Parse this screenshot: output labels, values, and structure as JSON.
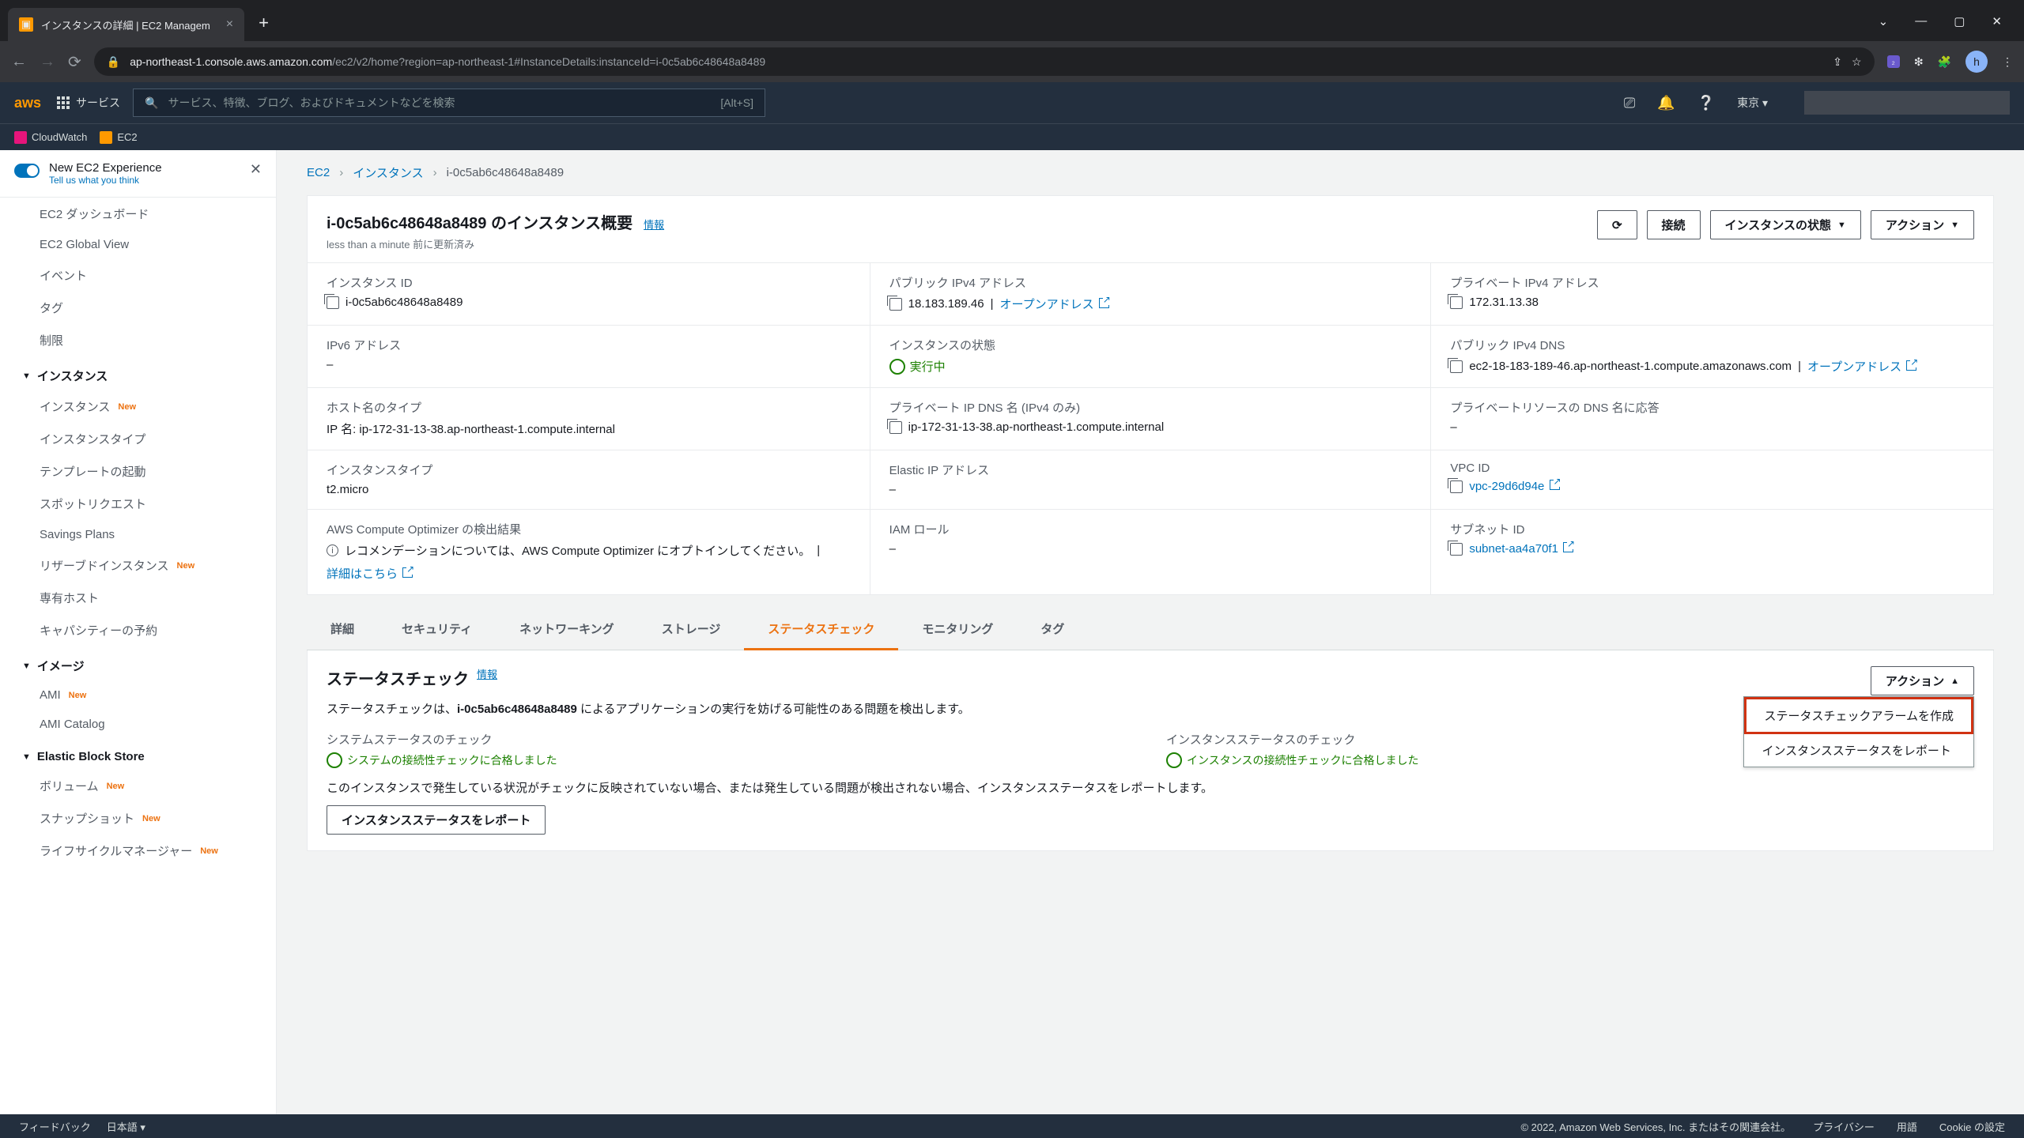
{
  "browser": {
    "tab_title": "インスタンスの詳細 | EC2 Managem",
    "url_host": "ap-northeast-1.console.aws.amazon.com",
    "url_path": "/ec2/v2/home?region=ap-northeast-1#InstanceDetails:instanceId=i-0c5ab6c48648a8489",
    "avatar": "h"
  },
  "aws_nav": {
    "services": "サービス",
    "search_placeholder": "サービス、特徴、ブログ、およびドキュメントなどを検索",
    "search_kbd": "[Alt+S]",
    "region": "東京 ▾",
    "fav1": "CloudWatch",
    "fav2": "EC2"
  },
  "sidebar": {
    "newexp_title": "New EC2 Experience",
    "newexp_sub": "Tell us what you think",
    "items_top": [
      "EC2 ダッシュボード",
      "EC2 Global View",
      "イベント",
      "タグ",
      "制限"
    ],
    "grp_instances": "インスタンス",
    "items_instances": [
      {
        "label": "インスタンス",
        "new": true
      },
      {
        "label": "インスタンスタイプ",
        "new": false
      },
      {
        "label": "テンプレートの起動",
        "new": false
      },
      {
        "label": "スポットリクエスト",
        "new": false
      },
      {
        "label": "Savings Plans",
        "new": false
      },
      {
        "label": "リザーブドインスタンス",
        "new": true
      },
      {
        "label": "専有ホスト",
        "new": false
      },
      {
        "label": "キャパシティーの予約",
        "new": false
      }
    ],
    "grp_images": "イメージ",
    "items_images": [
      {
        "label": "AMI",
        "new": true
      },
      {
        "label": "AMI Catalog",
        "new": false
      }
    ],
    "grp_ebs": "Elastic Block Store",
    "items_ebs": [
      {
        "label": "ボリューム",
        "new": true
      },
      {
        "label": "スナップショット",
        "new": true
      },
      {
        "label": "ライフサイクルマネージャー",
        "new": true
      }
    ]
  },
  "breadcrumb": {
    "ec2": "EC2",
    "instances": "インスタンス",
    "current": "i-0c5ab6c48648a8489"
  },
  "header": {
    "title": "i-0c5ab6c48648a8489 のインスタンス概要",
    "info": "情報",
    "updated": "less than a minute 前に更新済み",
    "btn_connect": "接続",
    "btn_state": "インスタンスの状態",
    "btn_actions": "アクション"
  },
  "details": {
    "instance_id_label": "インスタンス ID",
    "instance_id": "i-0c5ab6c48648a8489",
    "public_ipv4_label": "パブリック IPv4 アドレス",
    "public_ipv4": "18.183.189.46",
    "open_address": "オープンアドレス",
    "private_ipv4_label": "プライベート IPv4 アドレス",
    "private_ipv4": "172.31.13.38",
    "ipv6_label": "IPv6 アドレス",
    "ipv6": "–",
    "state_label": "インスタンスの状態",
    "state": "実行中",
    "public_dns_label": "パブリック IPv4 DNS",
    "public_dns": "ec2-18-183-189-46.ap-northeast-1.compute.amazonaws.com",
    "hostname_type_label": "ホスト名のタイプ",
    "hostname_type": "IP 名: ip-172-31-13-38.ap-northeast-1.compute.internal",
    "private_dns_label": "プライベート IP DNS 名 (IPv4 のみ)",
    "private_dns": "ip-172-31-13-38.ap-northeast-1.compute.internal",
    "private_resource_dns_label": "プライベートリソースの DNS 名に応答",
    "private_resource_dns": "–",
    "instance_type_label": "インスタンスタイプ",
    "instance_type": "t2.micro",
    "elastic_ip_label": "Elastic IP アドレス",
    "elastic_ip": "–",
    "vpc_label": "VPC ID",
    "vpc": "vpc-29d6d94e",
    "compute_opt_label": "AWS Compute Optimizer の検出結果",
    "compute_opt": "レコメンデーションについては、AWS Compute Optimizer にオプトインしてください。",
    "compute_opt_link": "詳細はこちら",
    "iam_label": "IAM ロール",
    "iam": "–",
    "subnet_label": "サブネット ID",
    "subnet": "subnet-aa4a70f1"
  },
  "tabs": {
    "t1": "詳細",
    "t2": "セキュリティ",
    "t3": "ネットワーキング",
    "t4": "ストレージ",
    "t5": "ステータスチェック",
    "t6": "モニタリング",
    "t7": "タグ"
  },
  "status": {
    "title": "ステータスチェック",
    "info": "情報",
    "desc_pre": "ステータスチェックは、",
    "desc_id": "i-0c5ab6c48648a8489",
    "desc_post": " によるアプリケーションの実行を妨げる可能性のある問題を検出します。",
    "btn_actions": "アクション",
    "sys_label": "システムステータスのチェック",
    "sys_val": "システムの接続性チェックに合格しました",
    "inst_label": "インスタンスステータスのチェック",
    "inst_val": "インスタンスの接続性チェックに合格しました",
    "note": "このインスタンスで発生している状況がチェックに反映されていない場合、または発生している問題が検出されない場合、インスタンスステータスをレポートします。",
    "btn_report": "インスタンスステータスをレポート",
    "dd_create": "ステータスチェックアラームを作成",
    "dd_report": "インスタンスステータスをレポート"
  },
  "footer": {
    "feedback": "フィードバック",
    "lang": "日本語 ▾",
    "copyright": "© 2022, Amazon Web Services, Inc. またはその関連会社。",
    "privacy": "プライバシー",
    "terms": "用語",
    "cookie": "Cookie の設定"
  }
}
